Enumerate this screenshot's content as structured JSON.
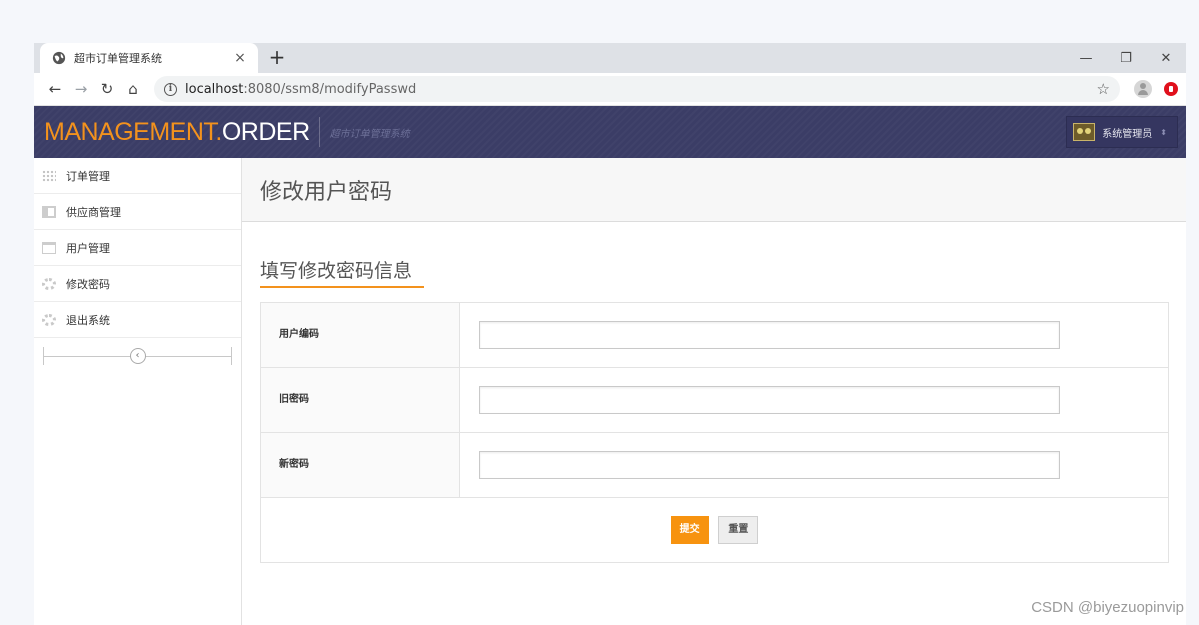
{
  "browser": {
    "tab_title": "超市订单管理系统",
    "tab_close": "×",
    "new_tab": "+",
    "url_host": "localhost",
    "url_path": ":8080/ssm8/modifyPasswd",
    "window_controls": {
      "minimize": "—",
      "restore": "❐",
      "close": "✕"
    }
  },
  "header": {
    "logo_part1": "MANAGEMENT.",
    "logo_part2": "ORDER",
    "subtitle": "超市订单管理系统",
    "user_name": "系统管理员",
    "user_caret": "⬍"
  },
  "sidebar": {
    "items": [
      {
        "label": "订单管理",
        "icon": "grid-icon"
      },
      {
        "label": "供应商管理",
        "icon": "block-icon"
      },
      {
        "label": "用户管理",
        "icon": "calendar-icon"
      },
      {
        "label": "修改密码",
        "icon": "lifebuoy-icon"
      },
      {
        "label": "退出系统",
        "icon": "lifebuoy-icon"
      }
    ],
    "collapse_symbol": "‹"
  },
  "page": {
    "title": "修改用户密码",
    "section_title": "填写修改密码信息",
    "fields": [
      {
        "label": "用户编码",
        "value": ""
      },
      {
        "label": "旧密码",
        "value": ""
      },
      {
        "label": "新密码",
        "value": ""
      }
    ],
    "submit_label": "提交",
    "reset_label": "重置"
  },
  "watermark": "CSDN @biyezuopinvip",
  "colors": {
    "accent": "#f3921d",
    "header_bg": "#3b3d66",
    "submit_bg": "#f7930f"
  }
}
